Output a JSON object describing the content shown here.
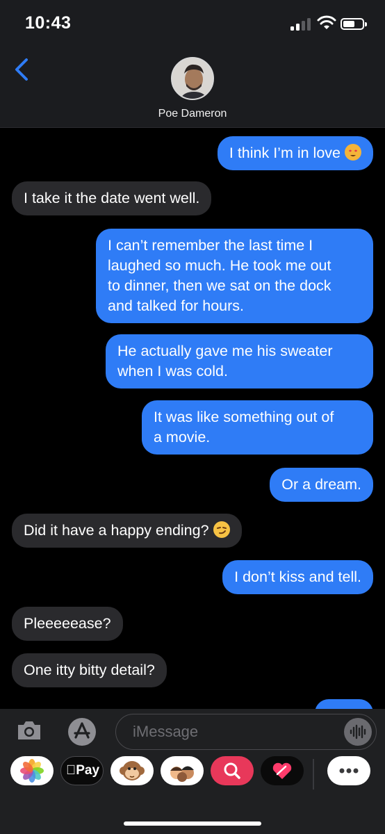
{
  "status": {
    "time": "10:43",
    "battery_level": 0.6
  },
  "contact": {
    "name": "Poe Dameron"
  },
  "messages": [
    {
      "from": "me",
      "text": "I think I’m in love",
      "emoji": "heart-eyes-cat"
    },
    {
      "from": "them",
      "text": "I take it the date went well."
    },
    {
      "from": "me",
      "lines": [
        "I can’t remember the last time I",
        "laughed so much. He took me out",
        "to dinner, then we sat on the dock",
        "and talked for hours."
      ]
    },
    {
      "from": "me",
      "lines": [
        "He actually gave me his sweater",
        "when I was cold."
      ]
    },
    {
      "from": "me",
      "lines": [
        "It was like something out of",
        "a movie."
      ]
    },
    {
      "from": "me",
      "text": "Or a dream."
    },
    {
      "from": "them",
      "text": "Did it have a happy ending?",
      "emoji": "smirk"
    },
    {
      "from": "me",
      "text": "I don’t kiss and tell."
    },
    {
      "from": "them",
      "text": "Pleeeeease?"
    },
    {
      "from": "them",
      "text": "One itty bitty detail?"
    }
  ],
  "composer": {
    "placeholder": "iMessage"
  },
  "drawer": {
    "apps": [
      "photos",
      "apple-pay",
      "monkey-animoji",
      "memoji",
      "images-search",
      "digital-touch",
      "more"
    ],
    "pay_label": "Pay"
  },
  "colors": {
    "sent": "#2f7cf6",
    "received": "#2a2a2d",
    "background": "#000000"
  }
}
